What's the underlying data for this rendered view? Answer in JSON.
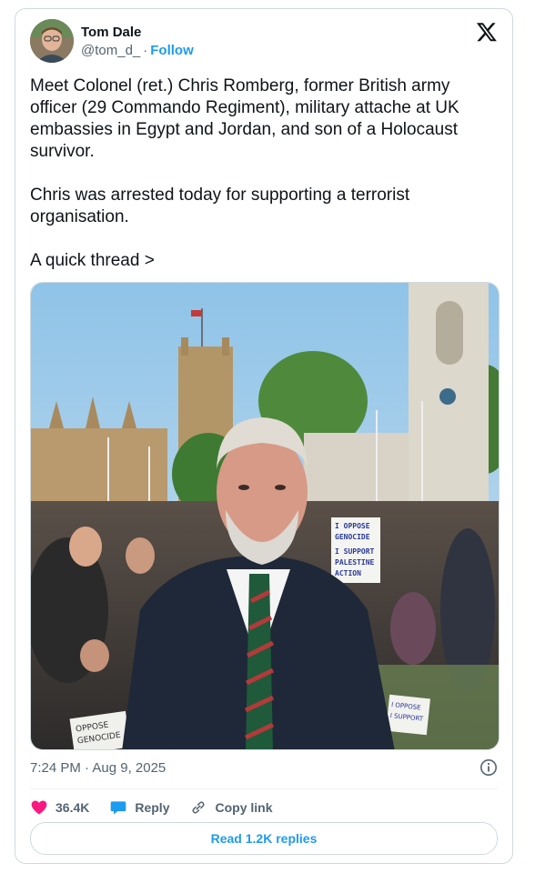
{
  "author": {
    "name": "Tom Dale",
    "handle": "@tom_d_",
    "separator": "·",
    "follow_label": "Follow"
  },
  "post": {
    "text": "Meet Colonel (ret.) Chris Romberg, former British army officer (29 Commando Regiment), military attache at UK embassies in Egypt and Jordan, and son of a Holocaust survivor.\n\nChris was arrested today for supporting a terrorist organisation.\n\nA quick thread >",
    "timestamp": "7:24 PM · Aug 9, 2025"
  },
  "photo": {
    "sign_main": [
      "I OPPOSE",
      "GENOCIDE",
      "I SUPPORT",
      "PALESTINE",
      "ACTION"
    ],
    "sign_bottom_left": [
      "OPPOSE",
      "GENOCIDE"
    ],
    "sign_bottom_right": [
      "I OPPOSE",
      "I SUPPORT"
    ]
  },
  "actions": {
    "likes": "36.4K",
    "reply_label": "Reply",
    "copy_label": "Copy link",
    "read_replies_label": "Read 1.2K replies"
  },
  "colors": {
    "accent": "#1d9bf0",
    "like": "#f91880",
    "secondary_text": "#536471"
  }
}
